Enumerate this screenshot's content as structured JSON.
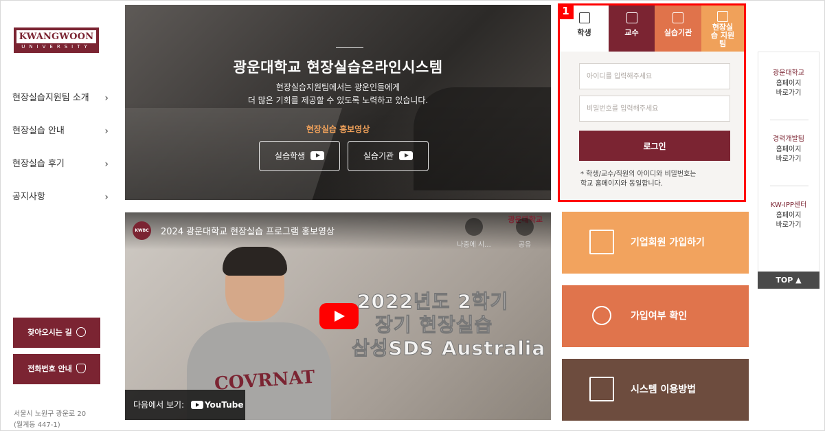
{
  "logo": {
    "main": "KWANGWOON",
    "sub": "UNIVERSITY"
  },
  "nav": [
    {
      "label": "현장실습지원팀 소개",
      "arrow": "›"
    },
    {
      "label": "현장실습 안내",
      "arrow": "›"
    },
    {
      "label": "현장실습 후기",
      "arrow": "›"
    },
    {
      "label": "공지사항",
      "arrow": "›"
    }
  ],
  "side_buttons": {
    "directions": "찾아오시는 길",
    "phone": "전화번호 안내"
  },
  "address": {
    "line1": "서울시 노원구 광운로 20",
    "line2": "(월계동 447-1)"
  },
  "hero": {
    "title": "광운대학교 현장실습온라인시스템",
    "sub1": "현장실습지원팀에서는 광운인들에게",
    "sub2": "더 많은 기회를 제공할 수 있도록 노력하고 있습니다.",
    "promo": "현장실습 홍보영상",
    "btn_student": "실습학생",
    "btn_org": "실습기관"
  },
  "video": {
    "channel": "KWBC",
    "title": "2024 광운대학교 현장실습 프로그램 홍보영상",
    "watch_later": "나중에 시...",
    "share": "공유",
    "stamp": "광운대학교",
    "overlay1": "2022년도 2학기",
    "overlay2": "장기 현장실습",
    "overlay3": "삼성SDS Australia",
    "shirt": "COVRNAT",
    "watch_on": "다음에서 보기:",
    "youtube": "YouTube"
  },
  "login": {
    "badge": "1",
    "tabs": [
      "학생",
      "교수",
      "실습기관",
      "현장실습 지원팀"
    ],
    "id_placeholder": "아이디를 입력해주세요",
    "pw_placeholder": "비밀번호를 입력해주세요",
    "submit": "로그인",
    "notice1": "* 학생/교수/직원의 아이디와 비밀번호는",
    "notice2": "학교 홈페이지와 동일합니다."
  },
  "cards": {
    "join": "기업회원 가입하기",
    "check": "가입여부 확인",
    "guide": "시스템 이용방법"
  },
  "quick_links": [
    {
      "title": "광운대학교",
      "l1": "홈페이지",
      "l2": "바로가기"
    },
    {
      "title": "경력개발팀",
      "l1": "홈페이지",
      "l2": "바로가기"
    },
    {
      "title": "KW-IPP센터",
      "l1": "홈페이지",
      "l2": "바로가기"
    }
  ],
  "top_label": "TOP ▲",
  "colors": {
    "brand": "#7b2432",
    "orange": "#e0734b",
    "light_orange": "#f0a15a",
    "brown": "#6d4c3e",
    "highlight": "#ff0000"
  }
}
